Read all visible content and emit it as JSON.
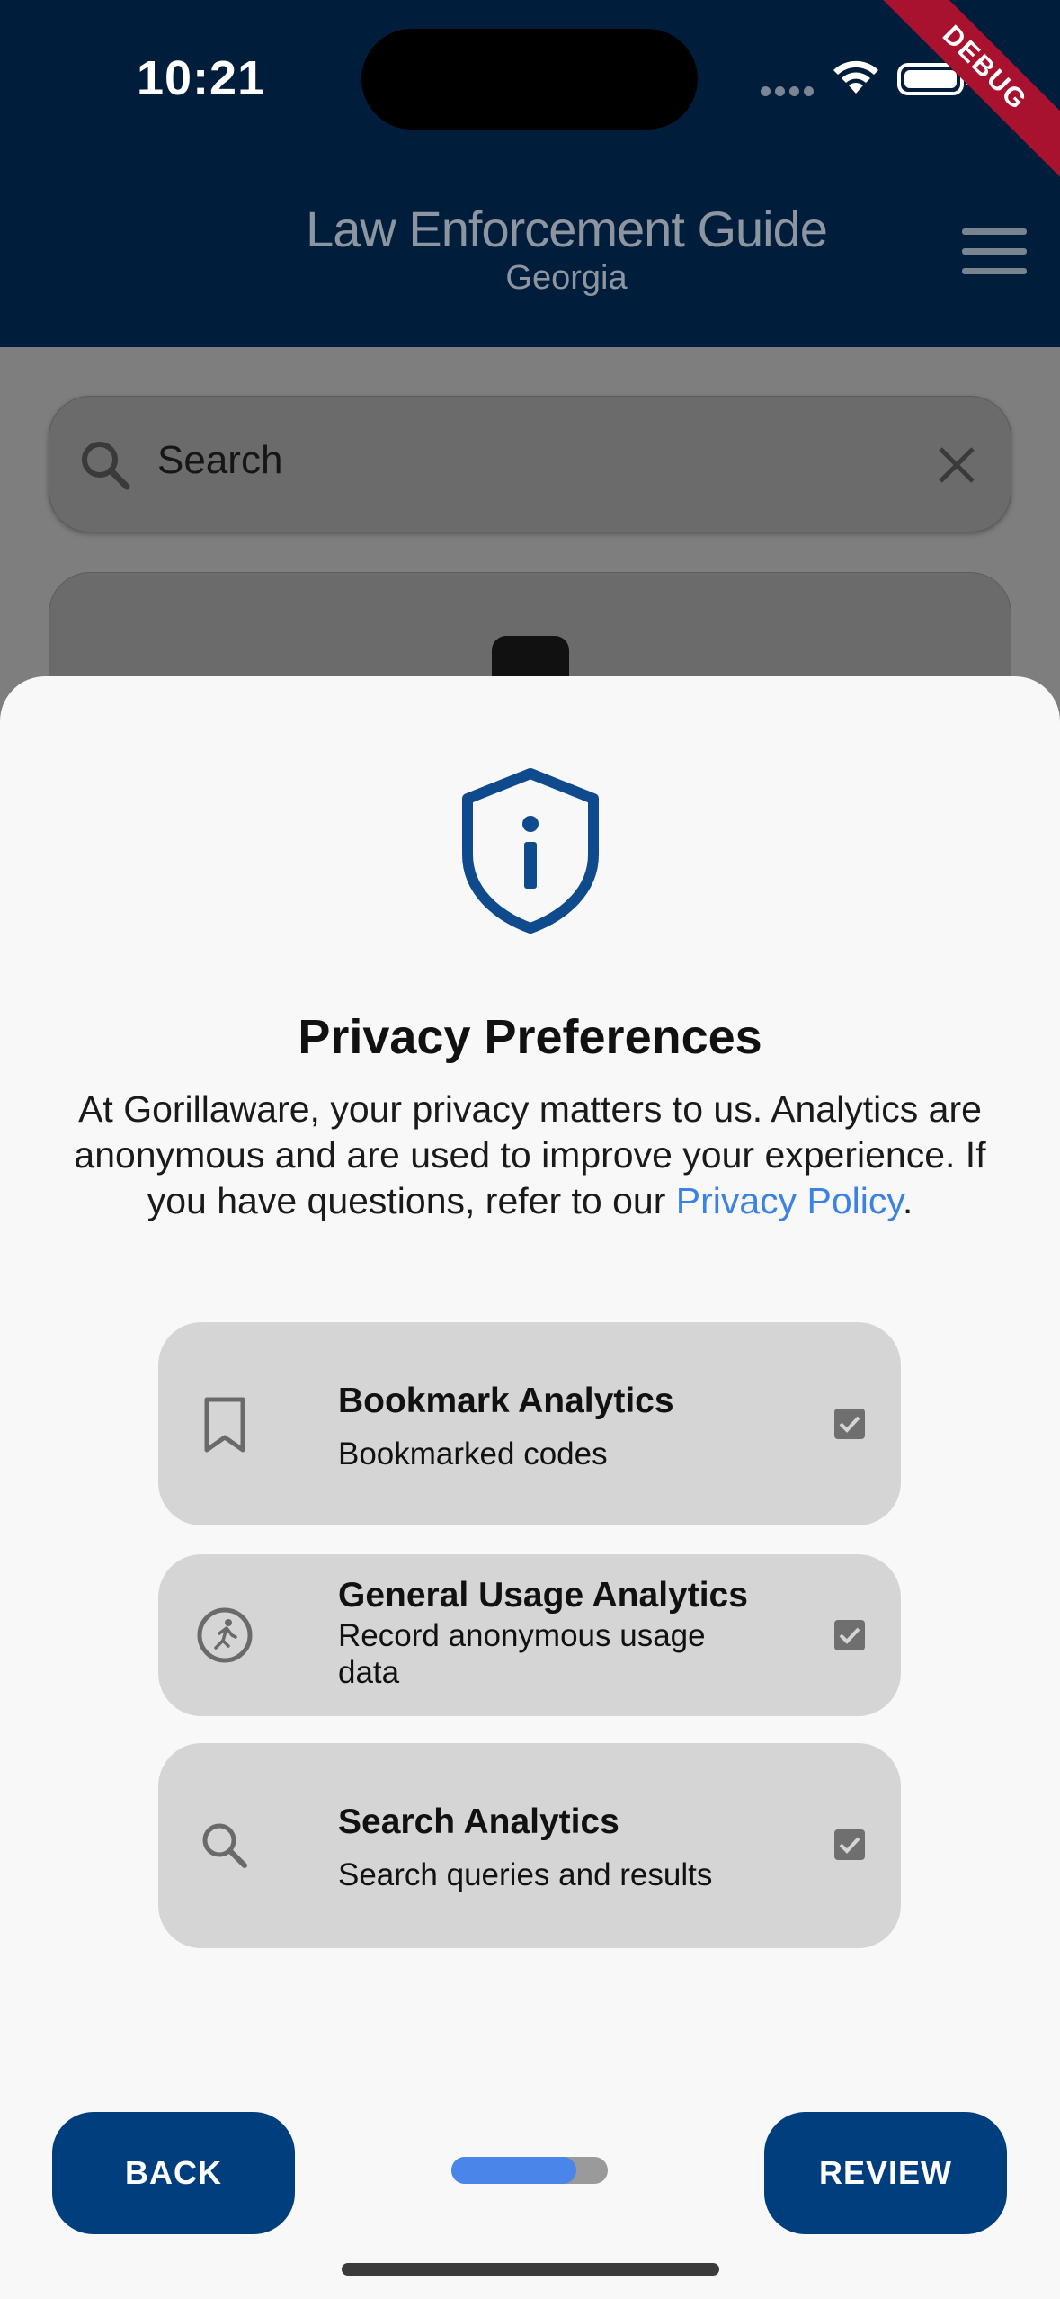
{
  "status_bar": {
    "time": "10:21"
  },
  "debug_banner": "DEBUG",
  "app_bar": {
    "title": "Law Enforcement Guide",
    "subtitle": "Georgia",
    "menu_icon": "hamburger-menu-icon"
  },
  "background": {
    "search": {
      "placeholder": "Search"
    }
  },
  "privacy_sheet": {
    "icon": "shield-info-icon",
    "title": "Privacy Preferences",
    "body_text": "At Gorillaware, your privacy matters to us. Analytics are anonymous and are used to improve your experience. If you have questions, refer to our ",
    "link_text": "Privacy Policy",
    "body_end": ".",
    "options": [
      {
        "icon": "bookmark-icon",
        "title": "Bookmark Analytics",
        "subtitle": "Bookmarked codes",
        "checked": true
      },
      {
        "icon": "running-person-icon",
        "title": "General Usage Analytics",
        "subtitle": "Record anonymous usage data",
        "checked": true
      },
      {
        "icon": "search-icon",
        "title": "Search Analytics",
        "subtitle": "Search queries and results",
        "checked": true
      }
    ],
    "back_label": "BACK",
    "review_label": "REVIEW",
    "progress": 0.8
  },
  "colors": {
    "app_bar": "#001d3b",
    "primary_button": "#003e7e",
    "link": "#3c82e4",
    "progress_fill": "#4a86ea"
  }
}
